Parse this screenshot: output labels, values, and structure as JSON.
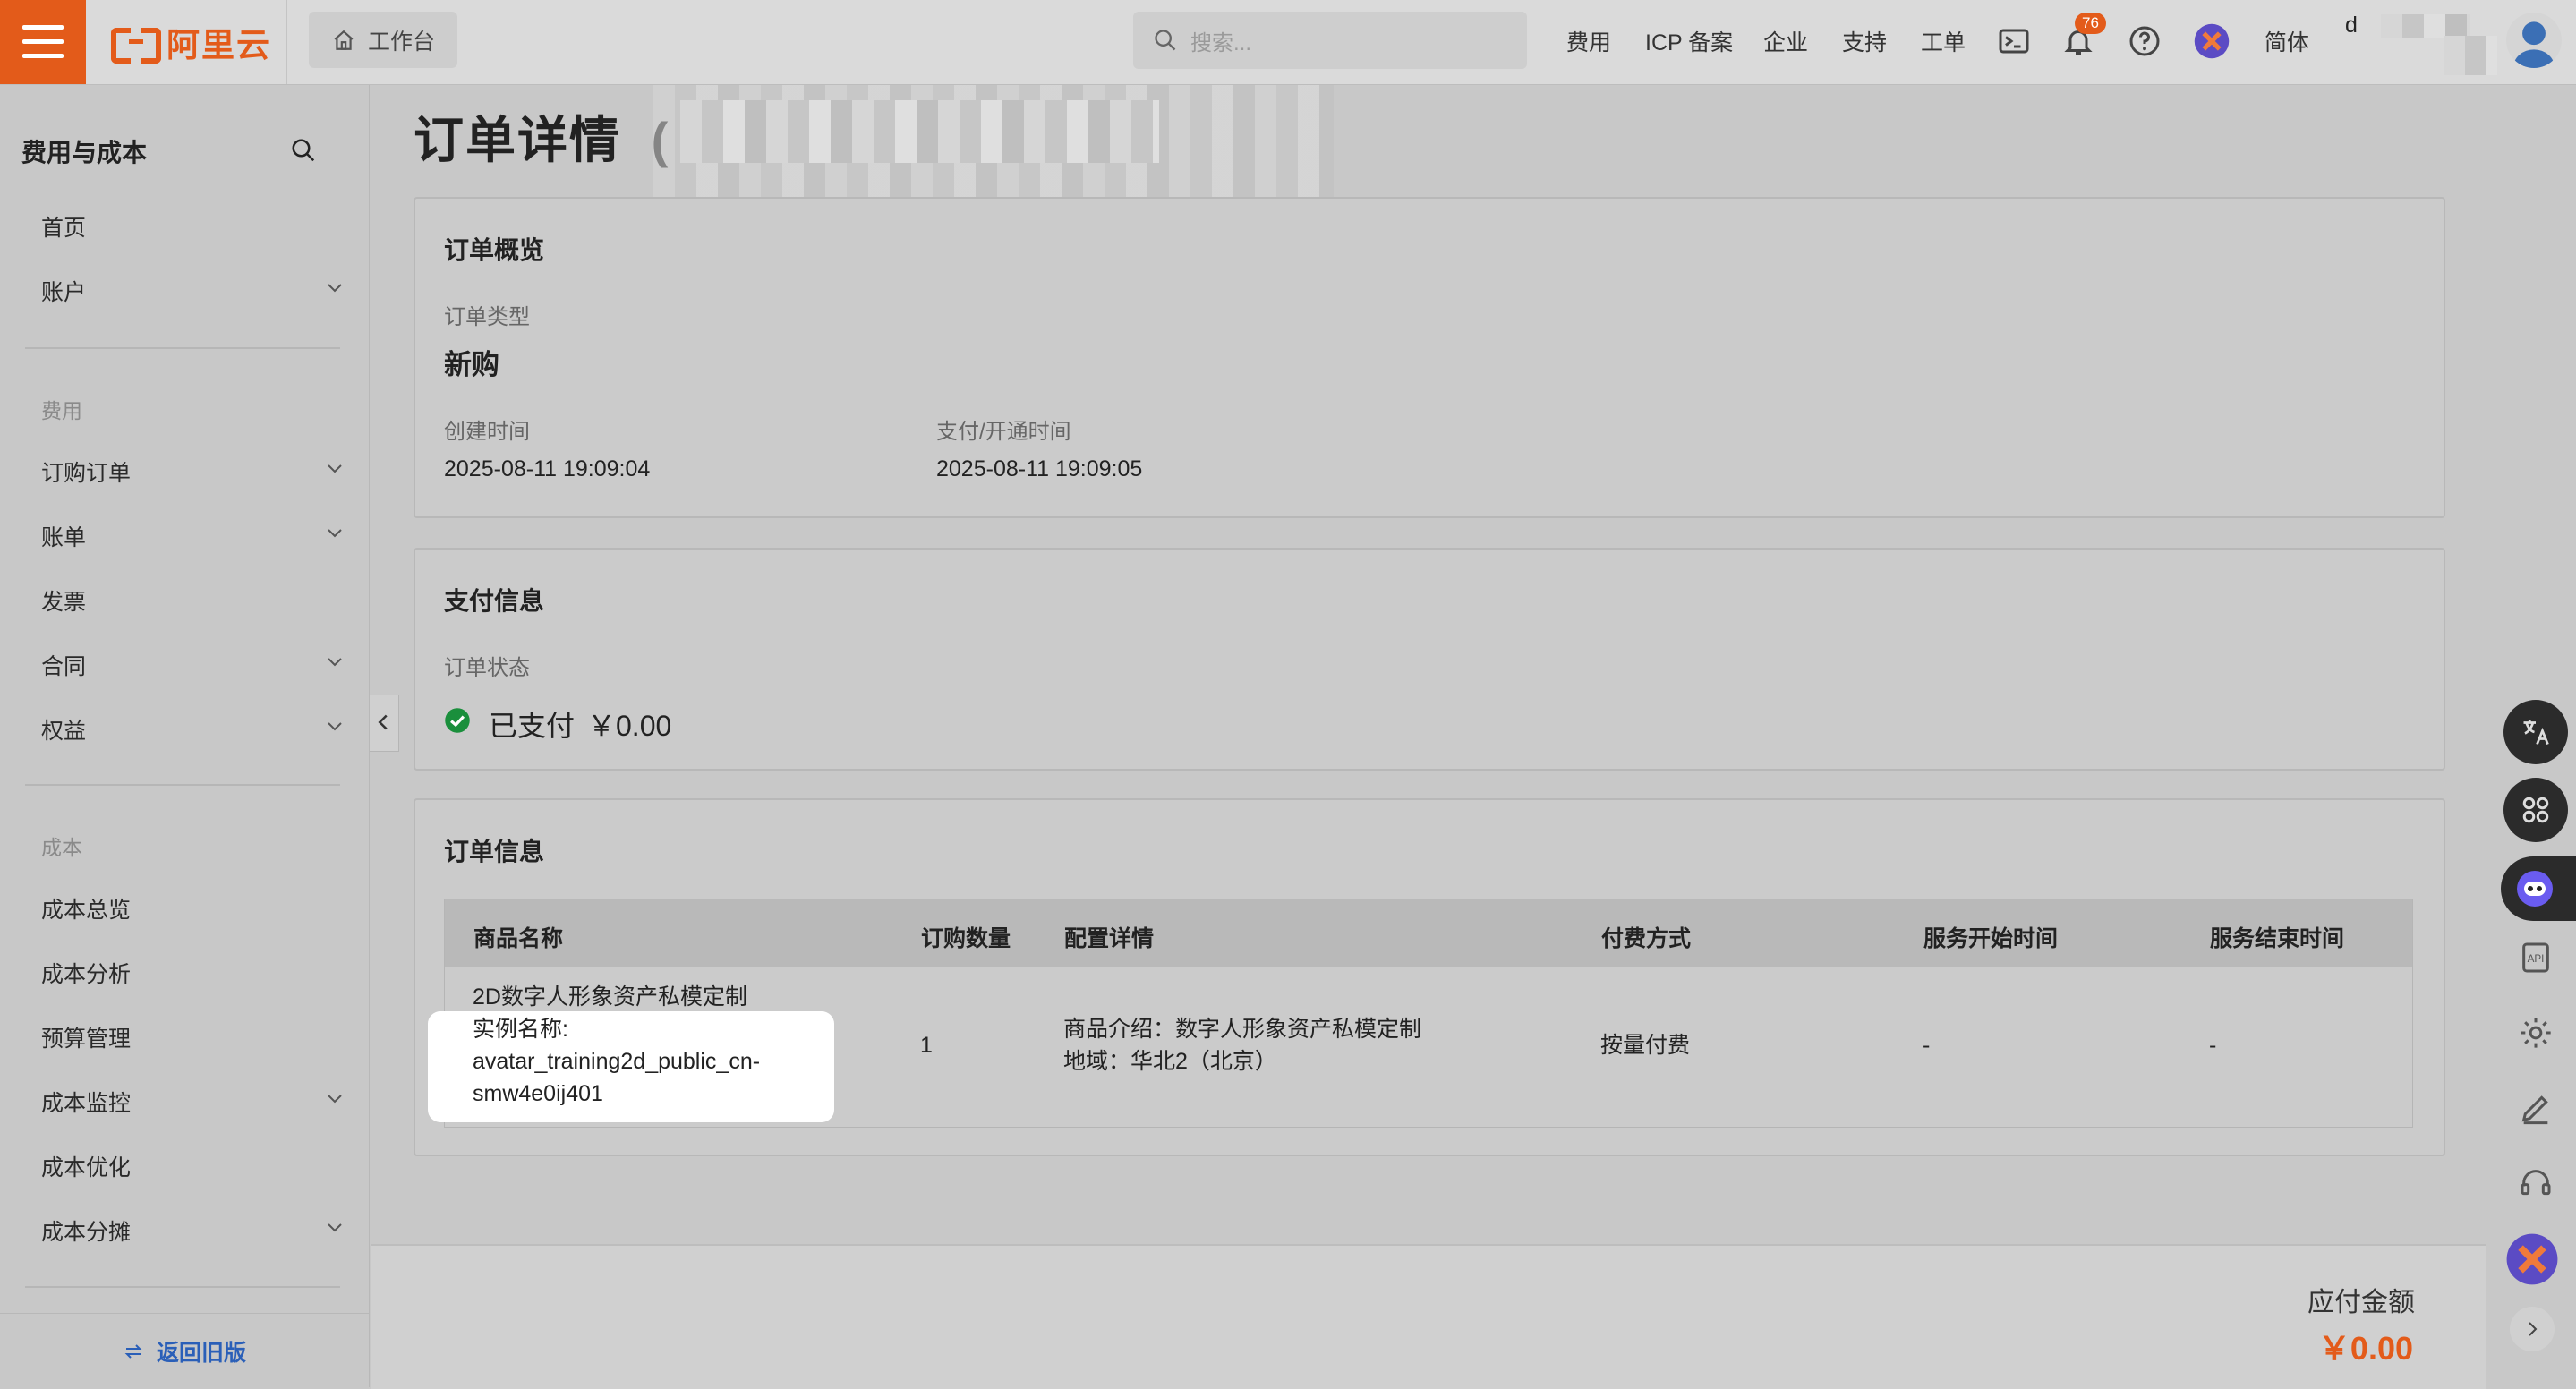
{
  "topbar": {
    "logo_text": "阿里云",
    "workbench_label": "工作台",
    "search_placeholder": "搜索...",
    "nav": [
      "费用",
      "ICP 备案",
      "企业",
      "支持",
      "工单"
    ],
    "notification_count": "76",
    "language_label": "简体",
    "user_initial": "d"
  },
  "sidebar": {
    "title": "费用与成本",
    "items_top": [
      {
        "label": "首页",
        "expandable": false
      },
      {
        "label": "账户",
        "expandable": true
      }
    ],
    "group_fee": "费用",
    "items_fee": [
      {
        "label": "订购订单",
        "expandable": true
      },
      {
        "label": "账单",
        "expandable": true
      },
      {
        "label": "发票",
        "expandable": false
      },
      {
        "label": "合同",
        "expandable": true
      },
      {
        "label": "权益",
        "expandable": true
      }
    ],
    "group_cost": "成本",
    "items_cost": [
      {
        "label": "成本总览",
        "expandable": false
      },
      {
        "label": "成本分析",
        "expandable": false
      },
      {
        "label": "预算管理",
        "expandable": false
      },
      {
        "label": "成本监控",
        "expandable": true
      },
      {
        "label": "成本优化",
        "expandable": false
      },
      {
        "label": "成本分摊",
        "expandable": true
      }
    ],
    "back_label": "返回旧版"
  },
  "main": {
    "title": "订单详情",
    "title_paren": "(",
    "overview": {
      "heading": "订单概览",
      "type_label": "订单类型",
      "type_value": "新购",
      "created_label": "创建时间",
      "created_value": "2025-08-11 19:09:04",
      "paid_label": "支付/开通时间",
      "paid_value": "2025-08-11 19:09:05"
    },
    "payment": {
      "heading": "支付信息",
      "status_label": "订单状态",
      "status_value": "已支付",
      "amount": "￥0.00",
      "status_color": "#1a8f3c"
    },
    "order_info": {
      "heading": "订单信息",
      "columns": [
        "商品名称",
        "订购数量",
        "配置详情",
        "付费方式",
        "服务开始时间",
        "服务结束时间"
      ],
      "row": {
        "product": "2D数字人形象资产私模定制",
        "instance_label": "实例名称:",
        "instance_line1": "avatar_training2d_public_cn-",
        "instance_line2": "smw4e0ij401",
        "quantity": "1",
        "config_line1": "商品介绍：数字人形象资产私模定制",
        "config_line2": "地域：华北2（北京）",
        "billing": "按量付费",
        "start": "-",
        "end": "-"
      }
    },
    "footer": {
      "label": "应付金额",
      "amount": "￥0.00",
      "amount_color": "#e35b1a"
    }
  },
  "rail_icons": [
    "translate-icon",
    "apps-icon",
    "assistant-icon",
    "api-icon",
    "settings-icon",
    "edit-icon",
    "headset-icon",
    "sparkle-icon",
    "chevron-right-icon"
  ]
}
